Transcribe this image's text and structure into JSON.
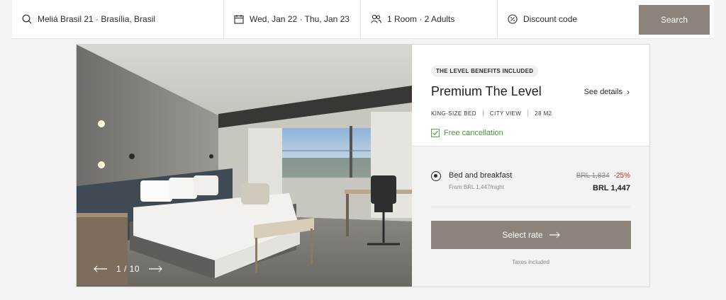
{
  "search": {
    "destination": "Meliá Brasil 21 · Brasília, Brasil",
    "dates": "Wed, Jan 22 · Thu, Jan 23",
    "occupancy": "1 Room · 2 Adults",
    "discount": "Discount code",
    "search_label": "Search",
    "icons": [
      "search-icon",
      "calendar-icon",
      "people-icon",
      "percent-icon"
    ]
  },
  "gallery": {
    "counter": "1 / 10"
  },
  "room": {
    "badge": "THE LEVEL BENEFITS INCLUDED",
    "title": "Premium The Level",
    "see_details": "See details",
    "features": [
      "KING-SIZE BED",
      "CITY VIEW",
      "28 M2"
    ],
    "free_cancellation": "Free cancellation"
  },
  "rate": {
    "name": "Bed and breakfast",
    "from": "From BRL 1,447/night",
    "old_price": "BRL 1,834",
    "discount": "-25%",
    "price": "BRL 1,447",
    "select_label": "Select rate",
    "taxes": "Taxes included"
  },
  "colors": {
    "button": "#8c847a",
    "green": "#4a9a3a",
    "discount_red": "#c0392b"
  }
}
